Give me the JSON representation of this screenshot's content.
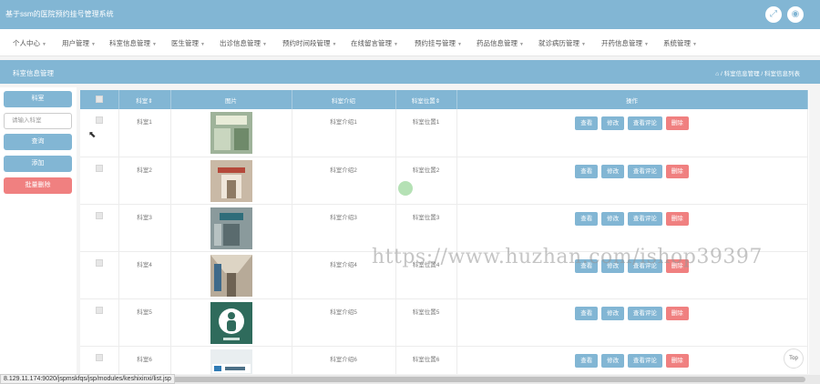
{
  "app": {
    "title": "基于ssm的医院预约挂号管理系统"
  },
  "header_icons": [
    "fullscreen-icon",
    "user-icon"
  ],
  "menu": [
    {
      "label": "个人中心"
    },
    {
      "label": "用户管理"
    },
    {
      "label": "科室信息管理"
    },
    {
      "label": "医生管理"
    },
    {
      "label": "出诊信息管理"
    },
    {
      "label": "预约时间段管理"
    },
    {
      "label": "在线留言管理"
    },
    {
      "label": "预约挂号管理"
    },
    {
      "label": "药品信息管理"
    },
    {
      "label": "就诊病历管理"
    },
    {
      "label": "开药信息管理"
    },
    {
      "label": "系统管理"
    }
  ],
  "section": {
    "title": "科室信息管理",
    "breadcrumb": "/ 科室信息管理 / 科室信息列表"
  },
  "sidebar": {
    "field_label": "科室",
    "search_placeholder": "请输入科室",
    "query_label": "查询",
    "add_label": "添加",
    "batch_delete_label": "批量删除"
  },
  "table": {
    "headers": [
      "",
      "科室",
      "图片",
      "科室介绍",
      "科室位置",
      "操作"
    ],
    "actions": {
      "view": "查看",
      "edit": "修改",
      "comments": "查看评论",
      "delete": "删除"
    },
    "rows": [
      {
        "name": "科室1",
        "intro": "科室介绍1",
        "location": "科室位置1"
      },
      {
        "name": "科室2",
        "intro": "科室介绍2",
        "location": "科室位置2"
      },
      {
        "name": "科室3",
        "intro": "科室介绍3",
        "location": "科室位置3"
      },
      {
        "name": "科室4",
        "intro": "科室介绍4",
        "location": "科室位置4"
      },
      {
        "name": "科室5",
        "intro": "科室介绍5",
        "location": "科室位置5"
      },
      {
        "name": "科室6",
        "intro": "科室介绍6",
        "location": "科室位置6"
      }
    ]
  },
  "status_url": "8.129.11.174:9020/jspmskfqs/jsp/modules/keshixinxi/list.jsp",
  "watermark": "https://www.huzhan.com/ishop39397",
  "top_button": "Top",
  "colors": {
    "primary": "#82b6d4",
    "danger": "#f08080"
  }
}
